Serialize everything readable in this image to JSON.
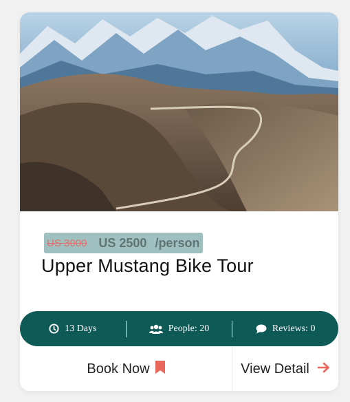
{
  "tour": {
    "old_price": "US 3000",
    "new_price": "US 2500",
    "per_unit": "/person",
    "title": "Upper Mustang Bike Tour"
  },
  "info": {
    "duration": "13 Days",
    "people": "People: 20",
    "reviews": "Reviews: 0"
  },
  "actions": {
    "book_label": "Book Now",
    "detail_label": "View Detail"
  },
  "icons": {
    "duration": "clock-icon",
    "people": "users-icon",
    "reviews": "comment-icon",
    "book": "bookmark-icon",
    "detail": "arrow-right-icon"
  },
  "colors": {
    "accent": "#0e5a57",
    "price_badge": "#9fc0bf",
    "old_price": "#e07070",
    "icon_accent": "#e8675a"
  }
}
